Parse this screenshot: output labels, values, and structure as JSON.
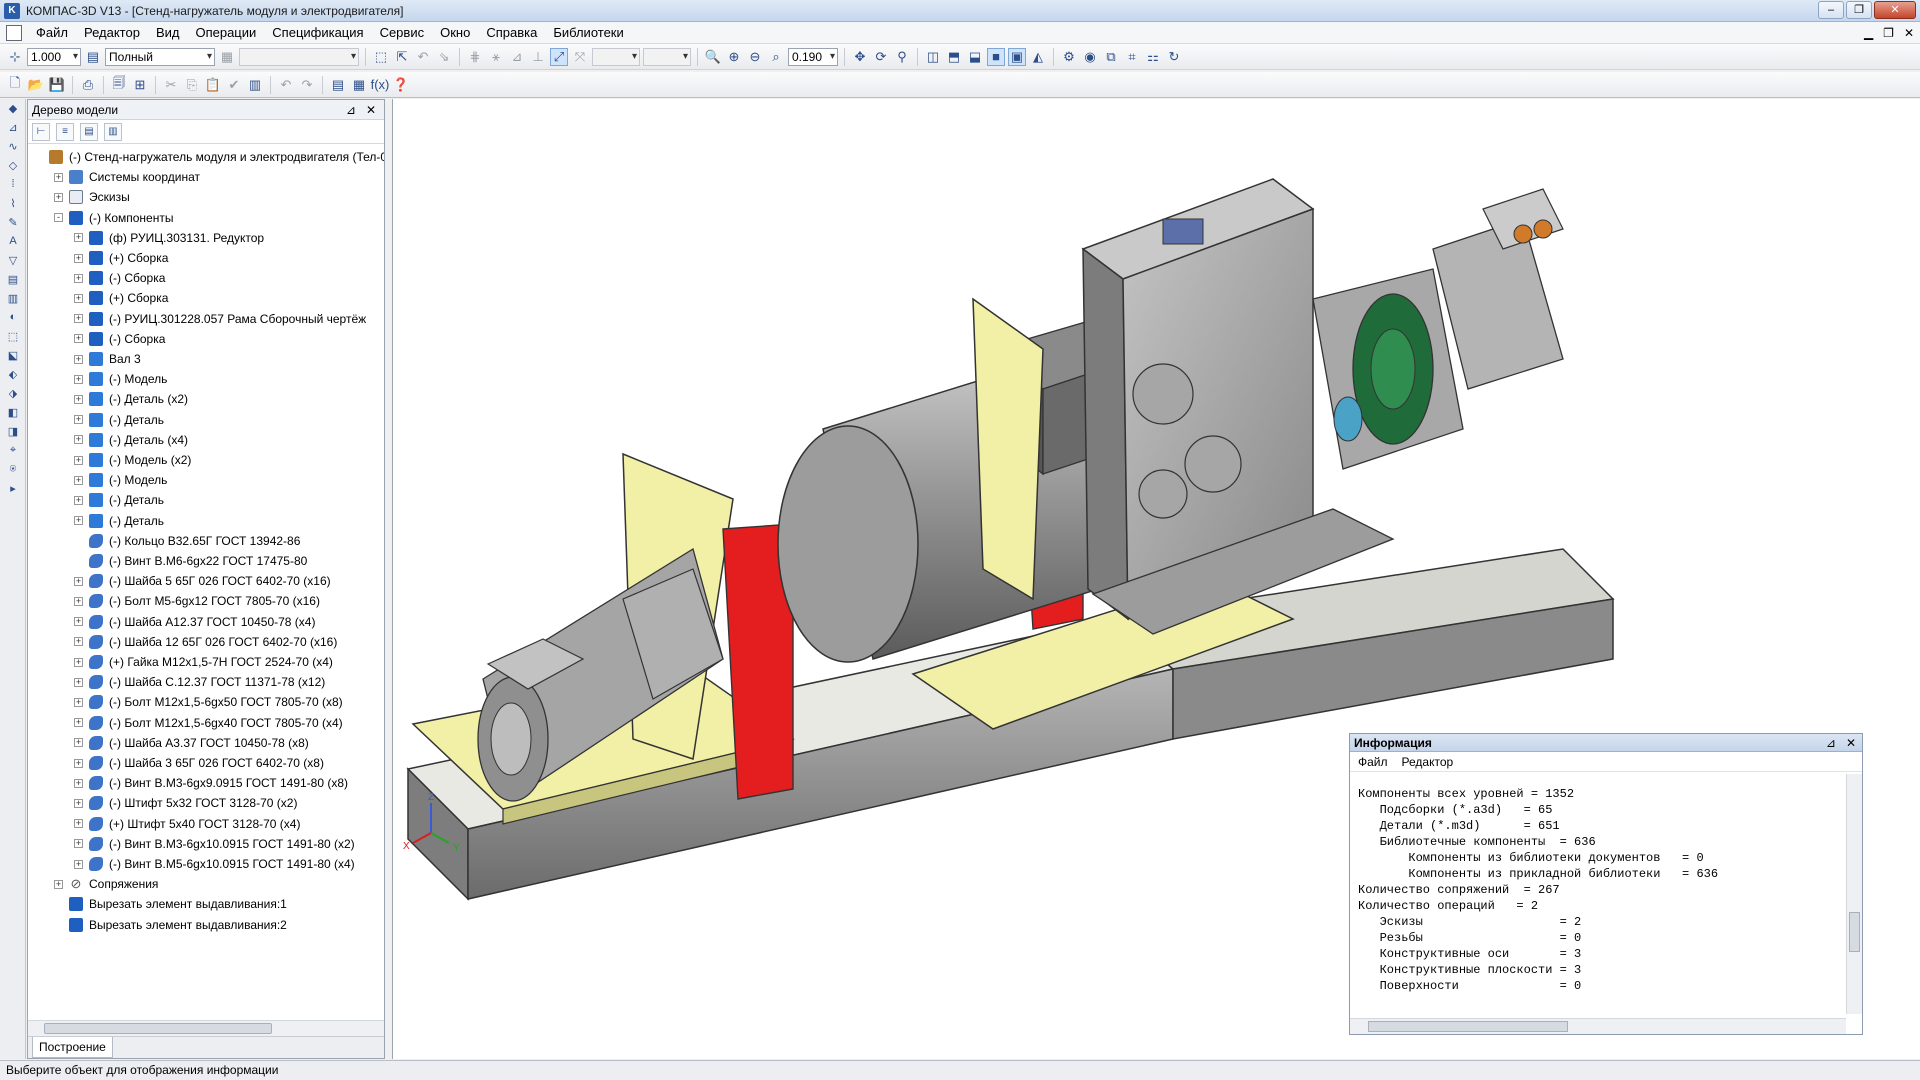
{
  "window": {
    "title": "КОМПАС-3D V13 - [Стенд-нагружатель модуля и электродвигателя]"
  },
  "menu": {
    "items": [
      "Файл",
      "Редактор",
      "Вид",
      "Операции",
      "Спецификация",
      "Сервис",
      "Окно",
      "Справка",
      "Библиотеки"
    ]
  },
  "toolbar1": {
    "scale_value": "1.000",
    "view_mode": "Полный",
    "zoom_value": "0.190"
  },
  "tree": {
    "panel_title": "Дерево модели",
    "bottom_tab": "Построение",
    "rows": [
      {
        "level": 0,
        "expander": "",
        "icon": "root-assembly-icon",
        "kind": "root",
        "label": "(-) Стенд-нагружатель  модуля и электродвигателя (Тел-0"
      },
      {
        "level": 1,
        "expander": "+",
        "icon": "coordinate-systems-icon",
        "kind": "cs",
        "label": "Системы координат"
      },
      {
        "level": 1,
        "expander": "+",
        "icon": "sketches-icon",
        "kind": "sk",
        "label": "Эскизы"
      },
      {
        "level": 1,
        "expander": "-",
        "icon": "components-icon",
        "kind": "asm",
        "label": "(-) Компоненты"
      },
      {
        "level": 2,
        "expander": "+",
        "icon": "assembly-icon",
        "kind": "asm",
        "label": "(ф) РУИЦ.303131. Редуктор"
      },
      {
        "level": 2,
        "expander": "+",
        "icon": "assembly-icon",
        "kind": "asm",
        "label": "(+) Сборка"
      },
      {
        "level": 2,
        "expander": "+",
        "icon": "assembly-icon",
        "kind": "asm",
        "label": "(-) Сборка"
      },
      {
        "level": 2,
        "expander": "+",
        "icon": "assembly-icon",
        "kind": "asm",
        "label": "(+) Сборка"
      },
      {
        "level": 2,
        "expander": "+",
        "icon": "assembly-icon",
        "kind": "asm",
        "label": "(-) РУИЦ.301228.057 Рама  Сборочный чертёж"
      },
      {
        "level": 2,
        "expander": "+",
        "icon": "assembly-icon",
        "kind": "asm",
        "label": "(-) Сборка"
      },
      {
        "level": 2,
        "expander": "+",
        "icon": "part-icon",
        "kind": "part",
        "label": "Вал 3"
      },
      {
        "level": 2,
        "expander": "+",
        "icon": "part-icon",
        "kind": "part",
        "label": "(-) Модель"
      },
      {
        "level": 2,
        "expander": "+",
        "icon": "part-icon",
        "kind": "part",
        "label": "(-) Деталь (x2)"
      },
      {
        "level": 2,
        "expander": "+",
        "icon": "part-icon",
        "kind": "part",
        "label": "(-) Деталь"
      },
      {
        "level": 2,
        "expander": "+",
        "icon": "part-icon",
        "kind": "part",
        "label": "(-) Деталь (x4)"
      },
      {
        "level": 2,
        "expander": "+",
        "icon": "part-icon",
        "kind": "part",
        "label": "(-) Модель (x2)"
      },
      {
        "level": 2,
        "expander": "+",
        "icon": "part-icon",
        "kind": "part",
        "label": "(-) Модель"
      },
      {
        "level": 2,
        "expander": "+",
        "icon": "part-icon",
        "kind": "part",
        "label": "(-) Деталь"
      },
      {
        "level": 2,
        "expander": "+",
        "icon": "part-icon",
        "kind": "part",
        "label": "(-) Деталь"
      },
      {
        "level": 2,
        "expander": "",
        "icon": "standard-part-icon",
        "kind": "std",
        "label": "(-) Кольцо В32.65Г ГОСТ 13942-86"
      },
      {
        "level": 2,
        "expander": "",
        "icon": "standard-part-icon",
        "kind": "std",
        "label": "(-) Винт В.М6-6gx22 ГОСТ 17475-80"
      },
      {
        "level": 2,
        "expander": "+",
        "icon": "standard-part-icon",
        "kind": "std",
        "label": "(-) Шайба 5 65Г 026 ГОСТ 6402-70 (x16)"
      },
      {
        "level": 2,
        "expander": "+",
        "icon": "standard-part-icon",
        "kind": "std",
        "label": "(-) Болт М5-6gx12 ГОСТ 7805-70 (x16)"
      },
      {
        "level": 2,
        "expander": "+",
        "icon": "standard-part-icon",
        "kind": "std",
        "label": "(-) Шайба А12.37 ГОСТ 10450-78 (x4)"
      },
      {
        "level": 2,
        "expander": "+",
        "icon": "standard-part-icon",
        "kind": "std",
        "label": "(-) Шайба 12 65Г 026 ГОСТ 6402-70 (x16)"
      },
      {
        "level": 2,
        "expander": "+",
        "icon": "standard-part-icon",
        "kind": "std",
        "label": "(+) Гайка М12x1,5-7Н ГОСТ 2524-70 (x4)"
      },
      {
        "level": 2,
        "expander": "+",
        "icon": "standard-part-icon",
        "kind": "std",
        "label": "(-) Шайба С.12.37 ГОСТ 11371-78 (x12)"
      },
      {
        "level": 2,
        "expander": "+",
        "icon": "standard-part-icon",
        "kind": "std",
        "label": "(-) Болт М12x1,5-6gx50 ГОСТ 7805-70 (x8)"
      },
      {
        "level": 2,
        "expander": "+",
        "icon": "standard-part-icon",
        "kind": "std",
        "label": "(-) Болт М12x1,5-6gx40 ГОСТ 7805-70 (x4)"
      },
      {
        "level": 2,
        "expander": "+",
        "icon": "standard-part-icon",
        "kind": "std",
        "label": "(-) Шайба А3.37 ГОСТ 10450-78 (x8)"
      },
      {
        "level": 2,
        "expander": "+",
        "icon": "standard-part-icon",
        "kind": "std",
        "label": "(-) Шайба 3 65Г 026 ГОСТ 6402-70 (x8)"
      },
      {
        "level": 2,
        "expander": "+",
        "icon": "standard-part-icon",
        "kind": "std",
        "label": "(-) Винт В.М3-6gx9.0915 ГОСТ 1491-80 (x8)"
      },
      {
        "level": 2,
        "expander": "+",
        "icon": "standard-part-icon",
        "kind": "std",
        "label": "(-) Штифт 5x32 ГОСТ 3128-70 (x2)"
      },
      {
        "level": 2,
        "expander": "+",
        "icon": "standard-part-icon",
        "kind": "std",
        "label": "(+) Штифт 5x40 ГОСТ 3128-70 (x4)"
      },
      {
        "level": 2,
        "expander": "+",
        "icon": "standard-part-icon",
        "kind": "std",
        "label": "(-) Винт В.М3-6gx10.0915 ГОСТ 1491-80 (x2)"
      },
      {
        "level": 2,
        "expander": "+",
        "icon": "standard-part-icon",
        "kind": "std",
        "label": "(-) Винт В.М5-6gx10.0915 ГОСТ 1491-80 (x4)"
      },
      {
        "level": 1,
        "expander": "+",
        "icon": "mates-icon",
        "kind": "mate",
        "label": "Сопряжения"
      },
      {
        "level": 1,
        "expander": "",
        "icon": "extrude-cut-icon",
        "kind": "cut",
        "label": "Вырезать элемент выдавливания:1"
      },
      {
        "level": 1,
        "expander": "",
        "icon": "extrude-cut-icon",
        "kind": "cut",
        "label": "Вырезать элемент выдавливания:2"
      }
    ]
  },
  "info": {
    "title": "Информация",
    "menu": [
      "Файл",
      "Редактор"
    ],
    "lines": [
      "Компоненты всех уровней = 1352",
      "   Подсборки (*.a3d)   = 65",
      "   Детали (*.m3d)      = 651",
      "   Библиотечные компоненты  = 636",
      "       Компоненты из библиотеки документов   = 0",
      "       Компоненты из прикладной библиотеки   = 636",
      "Количество сопряжений  = 267",
      "Количество операций   = 2",
      "   Эскизы                   = 2",
      "   Резьбы                   = 0",
      "   Конструктивные оси       = 3",
      "   Конструктивные плоскости = 3",
      "   Поверхности              = 0"
    ]
  },
  "axes": {
    "x": "X",
    "y": "Y",
    "z": "Z"
  },
  "status": {
    "text": "Выберите объект для отображения информации"
  },
  "colors": {
    "yellow_plate": "#f2f0a6",
    "red_support": "#e41e1e",
    "motor_grey": "#8c8c8c",
    "gear_green": "#1f6b3a"
  }
}
